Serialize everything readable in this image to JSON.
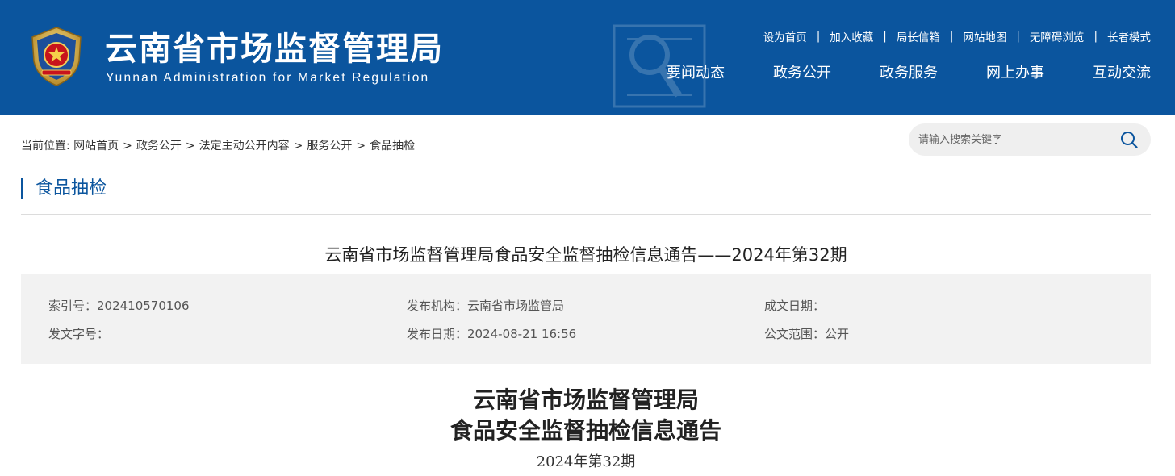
{
  "header": {
    "title": "云南省市场监督管理局",
    "subtitle": "Yunnan Administration for Market Regulation",
    "bg_color": "#0b559e",
    "top_links": [
      "设为首页",
      "加入收藏",
      "局长信箱",
      "网站地图",
      "无障碍浏览",
      "长者模式"
    ],
    "top_link_separator": "|",
    "nav": [
      "要闻动态",
      "政务公开",
      "政务服务",
      "网上办事",
      "互动交流"
    ]
  },
  "breadcrumb": {
    "prefix": "当前位置:",
    "items": [
      "网站首页",
      "政务公开",
      "法定主动公开内容",
      "服务公开",
      "食品抽检"
    ],
    "separator": ">"
  },
  "search": {
    "placeholder": "请输入搜索关键字",
    "icon": "search-icon"
  },
  "section": {
    "title": "食品抽检",
    "accent_color": "#0b559e"
  },
  "article": {
    "title": "云南省市场监督管理局食品安全监督抽检信息通告——2024年第32期",
    "meta": {
      "index": "索引号：202410570106",
      "publisher": "发布机构：云南省市场监管局",
      "created_date": "成文日期：",
      "doc_number": "发文字号：",
      "publish_date": "发布日期：2024-08-21 16:56",
      "scope": "公文范围：公开"
    },
    "doc_heading_line1": "云南省市场监督管理局",
    "doc_heading_line2": "食品安全监督抽检信息通告",
    "doc_issue": "2024年第32期"
  }
}
